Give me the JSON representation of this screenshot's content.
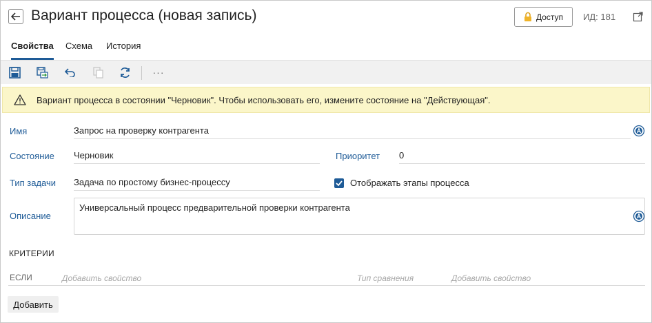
{
  "header": {
    "title": "Вариант процесса (новая запись)",
    "access_label": "Доступ",
    "id_text": "ИД: 181"
  },
  "tabs": [
    {
      "label": "Свойства",
      "active": true
    },
    {
      "label": "Схема",
      "active": false
    },
    {
      "label": "История",
      "active": false
    }
  ],
  "toolbar": {
    "more_label": "···"
  },
  "banner": {
    "text": "Вариант процесса в состоянии \"Черновик\". Чтобы использовать его, измените состояние на \"Действующая\"."
  },
  "form": {
    "name_label": "Имя",
    "name_value": "Запрос на проверку контрагента",
    "state_label": "Состояние",
    "state_value": "Черновик",
    "priority_label": "Приоритет",
    "priority_value": "0",
    "task_type_label": "Тип задачи",
    "task_type_value": "Задача по простому бизнес-процессу",
    "show_stages_label": "Отображать этапы процесса",
    "show_stages_checked": true,
    "description_label": "Описание",
    "description_value": "Универсальный процесс предварительной проверки контрагента"
  },
  "criteria": {
    "title": "КРИТЕРИИ",
    "if_label": "ЕСЛИ",
    "add_property_placeholder": "Добавить свойство",
    "comparison_placeholder": "Тип сравнения",
    "add_property_placeholder_2": "Добавить свойство",
    "add_button": "Добавить"
  },
  "colors": {
    "accent": "#1e5b97",
    "banner_bg": "#fbf6c9",
    "toolbar_bg": "#f1f1f1"
  }
}
